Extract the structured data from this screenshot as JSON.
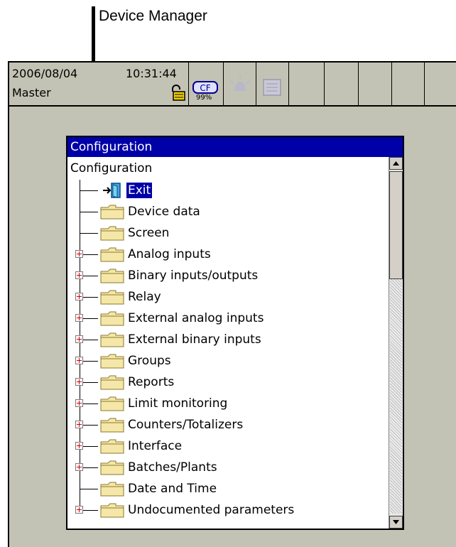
{
  "callout": {
    "label": "Device Manager"
  },
  "statusbar": {
    "date": "2006/08/04",
    "time": "10:31:44",
    "user": "Master",
    "cf_label": "CF",
    "cf_percent": "99%",
    "icons": [
      "lock-icon",
      "alarm-icon",
      "memory-icon"
    ]
  },
  "window": {
    "title": "Configuration",
    "tree_root": "Configuration",
    "items": [
      {
        "label": "Exit",
        "expandable": false,
        "icon": "exit-door-icon",
        "selected": true
      },
      {
        "label": "Device data",
        "expandable": false,
        "icon": "folder-icon"
      },
      {
        "label": "Screen",
        "expandable": false,
        "icon": "folder-icon"
      },
      {
        "label": "Analog inputs",
        "expandable": true,
        "icon": "folder-icon"
      },
      {
        "label": "Binary inputs/outputs",
        "expandable": true,
        "icon": "folder-icon"
      },
      {
        "label": "Relay",
        "expandable": true,
        "icon": "folder-icon"
      },
      {
        "label": "External analog inputs",
        "expandable": true,
        "icon": "folder-icon"
      },
      {
        "label": "External binary inputs",
        "expandable": true,
        "icon": "folder-icon"
      },
      {
        "label": "Groups",
        "expandable": true,
        "icon": "folder-icon"
      },
      {
        "label": "Reports",
        "expandable": true,
        "icon": "folder-icon"
      },
      {
        "label": "Limit monitoring",
        "expandable": true,
        "icon": "folder-icon"
      },
      {
        "label": "Counters/Totalizers",
        "expandable": true,
        "icon": "folder-icon"
      },
      {
        "label": "Interface",
        "expandable": true,
        "icon": "folder-icon"
      },
      {
        "label": "Batches/Plants",
        "expandable": true,
        "icon": "folder-icon"
      },
      {
        "label": "Date and Time",
        "expandable": false,
        "icon": "folder-icon"
      },
      {
        "label": "Undocumented parameters",
        "expandable": true,
        "icon": "folder-icon"
      }
    ]
  },
  "colors": {
    "screen_bg": "#c3c3b5",
    "title_bar": "#0000a8",
    "selection": "#0000a8",
    "expander_plus": "#d00000",
    "folder": "#f5e7a8"
  }
}
